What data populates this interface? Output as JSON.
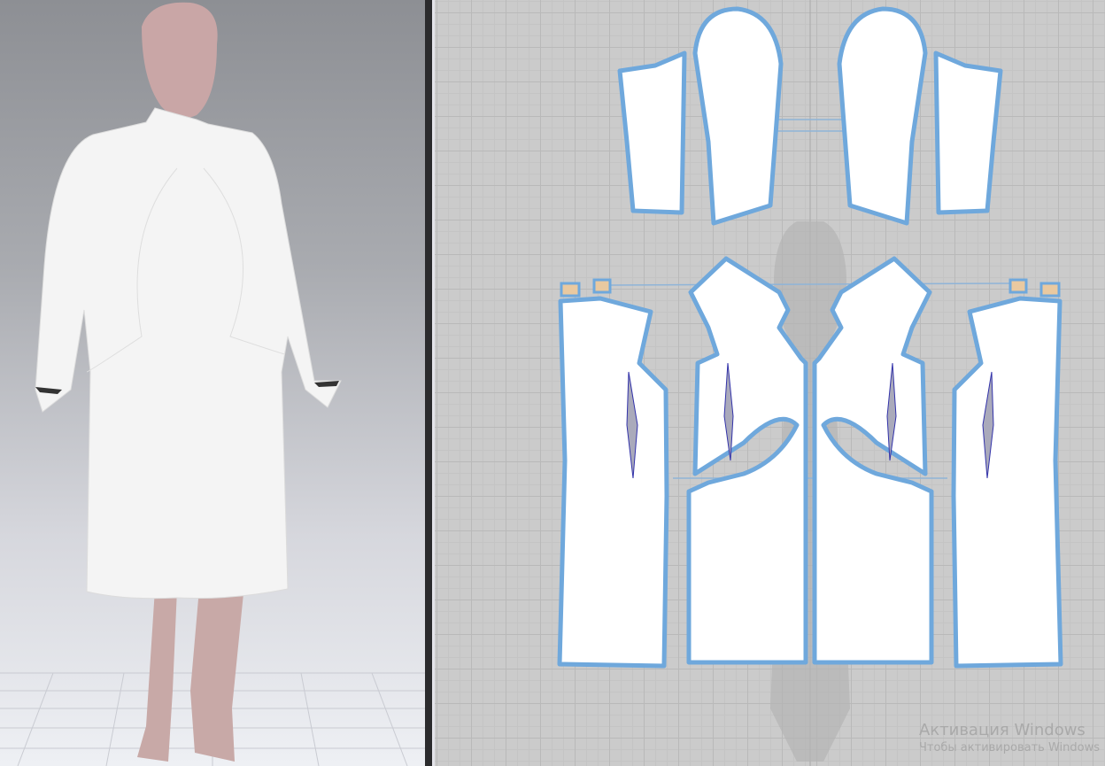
{
  "viewports": {
    "avatar_view": "3D garment view",
    "pattern_view": "2D pattern view"
  },
  "colors": {
    "seam_outline": "#6fa8dc",
    "piece_fill": "#ffffff",
    "grid_bg": "#cbcbcb",
    "skin": "#c8a9a7",
    "fusing": "#e9c9a0"
  },
  "watermark": {
    "title": "Активация Windows",
    "subtitle": "Чтобы активировать Windows"
  }
}
